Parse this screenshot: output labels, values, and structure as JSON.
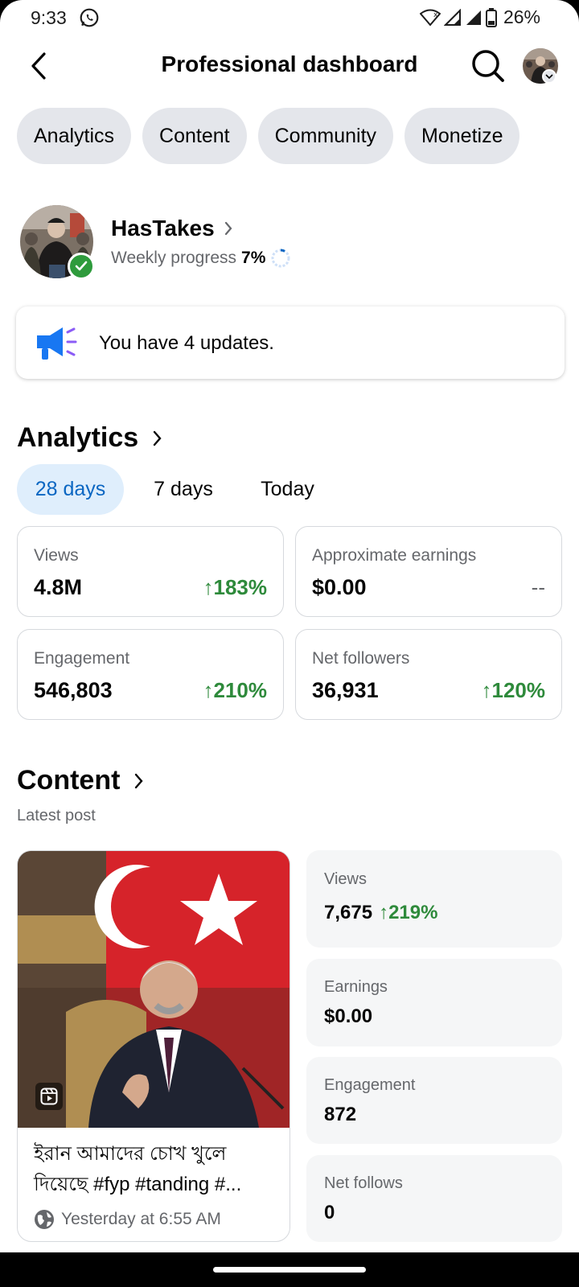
{
  "status_bar": {
    "time": "9:33",
    "battery": "26%"
  },
  "header": {
    "title": "Professional dashboard"
  },
  "chips": [
    "Analytics",
    "Content",
    "Community",
    "Monetize"
  ],
  "profile": {
    "name": "HasTakes",
    "weekly_label": "Weekly progress",
    "weekly_value": "7%"
  },
  "updates": {
    "text": "You have 4 updates."
  },
  "analytics": {
    "title": "Analytics",
    "ranges": [
      "28 days",
      "7 days",
      "Today"
    ],
    "metrics": [
      {
        "label": "Views",
        "value": "4.8M",
        "change": "↑183%"
      },
      {
        "label": "Approximate earnings",
        "value": "$0.00",
        "change": "--"
      },
      {
        "label": "Engagement",
        "value": "546,803",
        "change": "↑210%"
      },
      {
        "label": "Net followers",
        "value": "36,931",
        "change": "↑120%"
      }
    ]
  },
  "content": {
    "title": "Content",
    "latest_post_label": "Latest post",
    "post": {
      "caption": "ইরান আমাদের চোখ খুলে দিয়েছে #fyp #tanding #...",
      "time": "Yesterday at 6:55 AM"
    },
    "stats": [
      {
        "label": "Views",
        "value": "7,675",
        "change": "↑219%"
      },
      {
        "label": "Earnings",
        "value": "$0.00"
      },
      {
        "label": "Engagement",
        "value": "872"
      },
      {
        "label": "Net follows",
        "value": "0"
      }
    ]
  },
  "colors": {
    "accent_blue": "#0a66c2",
    "positive_green": "#2e8a3b",
    "chip_gray": "#e4e6eb"
  }
}
